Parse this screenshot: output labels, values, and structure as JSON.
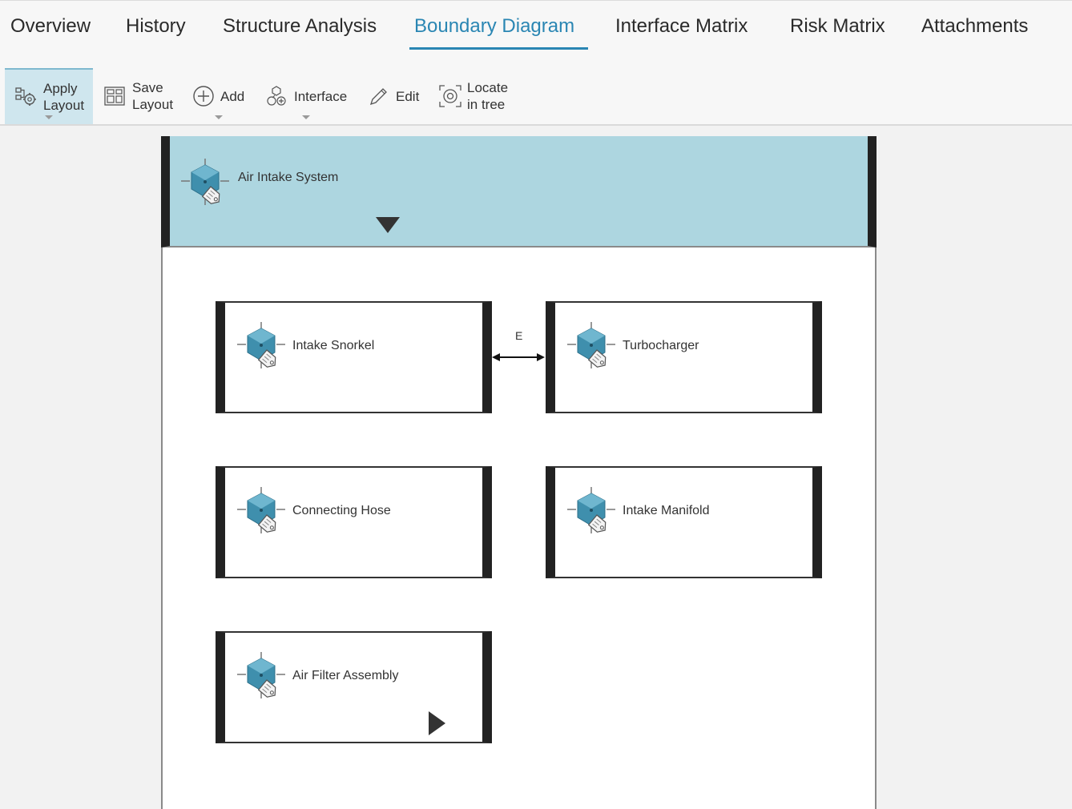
{
  "tabs": [
    {
      "label": "Overview",
      "active": false
    },
    {
      "label": "History",
      "active": false
    },
    {
      "label": "Structure Analysis",
      "active": false
    },
    {
      "label": "Boundary Diagram",
      "active": true
    },
    {
      "label": "Interface Matrix",
      "active": false
    },
    {
      "label": "Risk Matrix",
      "active": false
    },
    {
      "label": "Attachments",
      "active": false
    }
  ],
  "toolbar": {
    "apply_layout": "Apply\nLayout",
    "save_layout": "Save\nLayout",
    "add": "Add",
    "interface": "Interface",
    "edit": "Edit",
    "locate": "Locate\nin tree"
  },
  "diagram": {
    "system": {
      "name": "Air Intake System"
    },
    "components": [
      {
        "name": "Intake Snorkel"
      },
      {
        "name": "Turbocharger"
      },
      {
        "name": "Connecting Hose"
      },
      {
        "name": "Intake Manifold"
      },
      {
        "name": "Air Filter Assembly"
      }
    ],
    "connections": [
      {
        "from": "Intake Snorkel",
        "to": "Turbocharger",
        "label": "E"
      }
    ]
  },
  "colors": {
    "accent": "#2a86b3",
    "system_header": "#add6e0",
    "toolbar_active": "#cfe6ee",
    "icon_fill": "#3f8fad"
  }
}
